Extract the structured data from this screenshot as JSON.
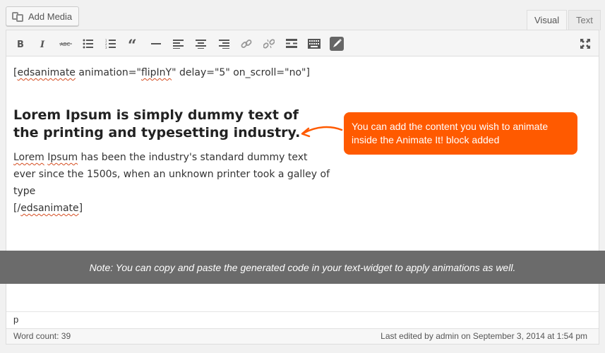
{
  "header": {
    "add_media_label": "Add Media",
    "tabs": [
      {
        "label": "Visual",
        "active": true
      },
      {
        "label": "Text",
        "active": false
      }
    ]
  },
  "toolbar": {
    "buttons": [
      {
        "name": "bold",
        "icon": "bold-icon"
      },
      {
        "name": "italic",
        "icon": "italic-icon"
      },
      {
        "name": "strikethrough",
        "icon": "strikethrough-icon"
      },
      {
        "name": "bulleted-list",
        "icon": "bulleted-list-icon"
      },
      {
        "name": "numbered-list",
        "icon": "numbered-list-icon"
      },
      {
        "name": "blockquote",
        "icon": "blockquote-icon"
      },
      {
        "name": "horizontal-line",
        "icon": "horizontal-line-icon"
      },
      {
        "name": "align-left",
        "icon": "align-left-icon"
      },
      {
        "name": "align-center",
        "icon": "align-center-icon"
      },
      {
        "name": "align-right",
        "icon": "align-right-icon"
      },
      {
        "name": "insert-link",
        "icon": "link-icon"
      },
      {
        "name": "remove-link",
        "icon": "unlink-icon"
      },
      {
        "name": "read-more",
        "icon": "read-more-icon"
      },
      {
        "name": "toolbar-toggle",
        "icon": "keyboard-icon"
      },
      {
        "name": "animate-it",
        "icon": "animate-it-icon"
      },
      {
        "name": "fullscreen",
        "icon": "fullscreen-icon"
      }
    ]
  },
  "content": {
    "shortcode_open": {
      "tag": "edsanimate",
      "rest_a": " animation=\"",
      "effect": "flipInY",
      "rest_b": "\" delay=\"5\" on_scroll=\"no\"]"
    },
    "heading": "Lorem Ipsum is simply dummy text of the printing and typesetting industry.",
    "body": {
      "word1": "Lorem",
      "word2": "Ipsum",
      "rest": " has been the industry's standard dummy text ever since the 1500s, when an unknown printer took a galley of type"
    },
    "shortcode_close": {
      "tag": "edsanimate"
    }
  },
  "callout": {
    "text": "You can add the content you wish to animate inside the Animate It! block added",
    "color": "#ff5a00"
  },
  "note": "Note: You can copy and paste the generated code in your text-widget to apply animations as well.",
  "footer": {
    "path": "p",
    "word_count": "Word count: 39",
    "last_edited": "Last edited by admin on September 3, 2014 at 1:54 pm"
  }
}
